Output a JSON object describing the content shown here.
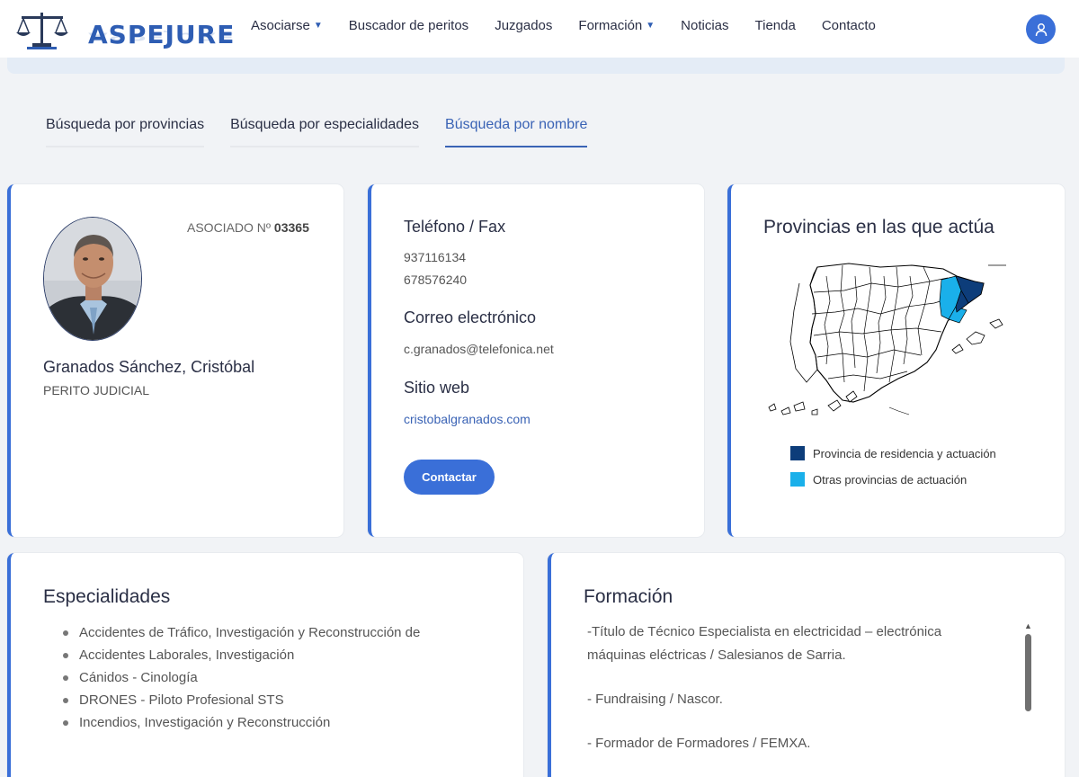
{
  "header": {
    "logo_text": "ASPEJURE",
    "nav": [
      {
        "label": "Asociarse",
        "dropdown": true
      },
      {
        "label": "Buscador de peritos",
        "dropdown": false
      },
      {
        "label": "Juzgados",
        "dropdown": false
      },
      {
        "label": "Formación",
        "dropdown": true
      },
      {
        "label": "Noticias",
        "dropdown": false
      },
      {
        "label": "Tienda",
        "dropdown": false
      },
      {
        "label": "Contacto",
        "dropdown": false
      }
    ],
    "user_icon": "user-icon"
  },
  "tabs": [
    {
      "label": "Búsqueda por provincias",
      "active": false
    },
    {
      "label": "Búsqueda por especialidades",
      "active": false
    },
    {
      "label": "Búsqueda por nombre",
      "active": true
    }
  ],
  "profile": {
    "assoc_label": "ASOCIADO Nº",
    "assoc_number": "03365",
    "name": "Granados Sánchez, Cristóbal",
    "role": "PERITO JUDICIAL"
  },
  "contact": {
    "phone_heading": "Teléfono / Fax",
    "phones": [
      "937116134",
      "678576240"
    ],
    "email_heading": "Correo electrónico",
    "email": "c.granados@telefonica.net",
    "web_heading": "Sitio web",
    "web": "cristobalgranados.com",
    "button": "Contactar"
  },
  "provinces": {
    "title": "Provincias en las que actúa",
    "legend": [
      {
        "label": "Provincia de residencia y actuación",
        "color": "#0d3d7a"
      },
      {
        "label": "Otras provincias de actuación",
        "color": "#1ab0ea"
      }
    ]
  },
  "specialties": {
    "title": "Especialidades",
    "items": [
      "Accidentes de Tráfico, Investigación y Reconstrucción de",
      "Accidentes Laborales, Investigación",
      "Cánidos - Cinología",
      "DRONES - Piloto Profesional STS",
      "Incendios, Investigación y Reconstrucción"
    ]
  },
  "training": {
    "title": "Formación",
    "lines": [
      "-Título de Técnico Especialista en electricidad – electrónica",
      "máquinas eléctricas / Salesianos de Sarria.",
      "- Fundraising / Nascor.",
      "- Formador de Formadores / FEMXA."
    ]
  },
  "colors": {
    "accent": "#3a6fd8",
    "link": "#3a63b5"
  }
}
